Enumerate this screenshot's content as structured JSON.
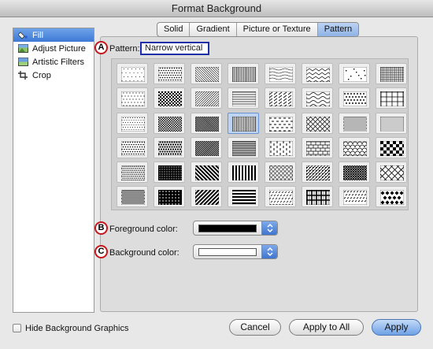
{
  "window": {
    "title": "Format Background"
  },
  "sidebar": {
    "items": [
      {
        "label": "Fill",
        "icon": "fill-bucket-icon",
        "selected": true
      },
      {
        "label": "Adjust Picture",
        "icon": "adjust-picture-icon",
        "selected": false
      },
      {
        "label": "Artistic Filters",
        "icon": "artistic-filters-icon",
        "selected": false
      },
      {
        "label": "Crop",
        "icon": "crop-icon",
        "selected": false
      }
    ]
  },
  "tabs": [
    {
      "label": "Solid",
      "active": false
    },
    {
      "label": "Gradient",
      "active": false
    },
    {
      "label": "Picture or Texture",
      "active": false
    },
    {
      "label": "Pattern",
      "active": true
    }
  ],
  "callouts": {
    "a": "A",
    "b": "B",
    "c": "C"
  },
  "pattern": {
    "label": "Pattern:",
    "value": "Narrow vertical",
    "selected_index": 19,
    "rows": [
      [
        "dots-sparse",
        "dots-medium",
        "diag-down-light",
        "vertical-narrow",
        "wave-light",
        "zigzag",
        "confetti",
        "grid-small"
      ],
      [
        "dots-light",
        "checker-small",
        "diag-up-light",
        "horizontal-narrow",
        "diag-up-dashed",
        "wave",
        "dots-diamond",
        "grid-large"
      ],
      [
        "dots-fine",
        "checker-dense",
        "diag-down-dark",
        "vertical-narrow-selected",
        "dash-horizontal",
        "diamond-outline",
        "dots-dense",
        "dots-grid"
      ],
      [
        "dots-medium",
        "dots-large",
        "diag-up-dark",
        "horizontal-dark",
        "dash-vertical",
        "brick",
        "scale",
        "checkerboard"
      ],
      [
        "dots-gray",
        "dots-black",
        "diag-down-wide",
        "vertical-wide",
        "sphere",
        "weave",
        "trellis",
        "diamond-outline-large"
      ],
      [
        "dots-heavy",
        "dots-white-on-black",
        "diag-up-wide",
        "horizontal-wide",
        "shingle",
        "plaid",
        "divot",
        "diamond-solid"
      ]
    ]
  },
  "foreground": {
    "label": "Foreground color:",
    "color": "#000000"
  },
  "background": {
    "label": "Background color:",
    "color": "#ffffff"
  },
  "footer": {
    "hide_graphics_label": "Hide Background Graphics",
    "hide_graphics_checked": false,
    "cancel_label": "Cancel",
    "apply_all_label": "Apply to All",
    "apply_label": "Apply"
  }
}
